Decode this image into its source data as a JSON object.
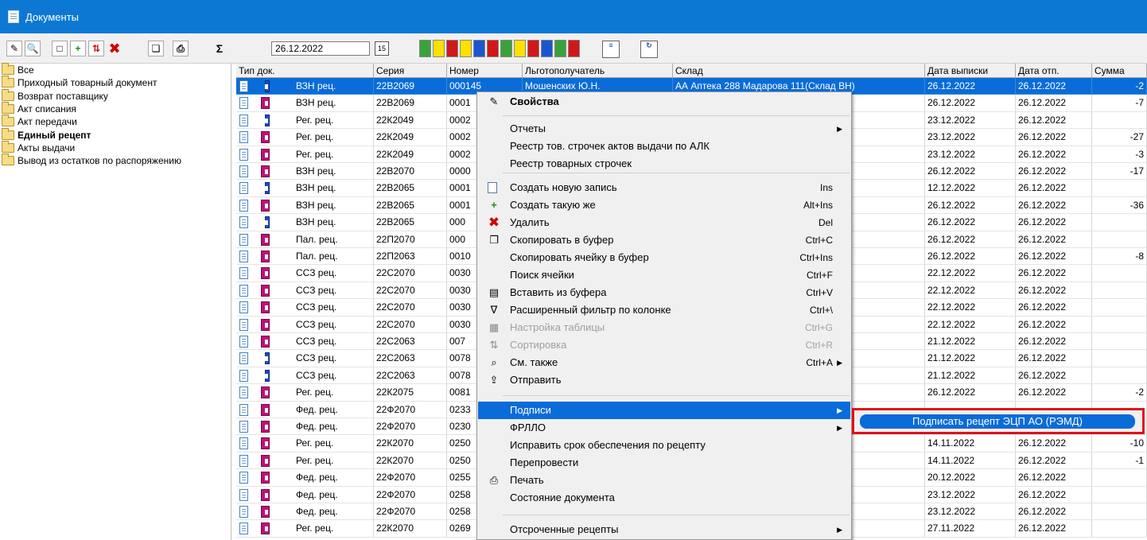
{
  "window": {
    "title": "Документы"
  },
  "toolbar": {
    "date_value": "26.12.2022",
    "calendar_label": "15"
  },
  "tree": {
    "items": [
      {
        "label": "Все"
      },
      {
        "label": "Приходный товарный документ"
      },
      {
        "label": "Возврат поставщику"
      },
      {
        "label": "Акт списания"
      },
      {
        "label": "Акт передачи"
      },
      {
        "label": "Единый рецепт",
        "bold": true
      },
      {
        "label": "Акты выдачи"
      },
      {
        "label": "Вывод из остатков по распоряжению"
      }
    ]
  },
  "grid": {
    "columns": [
      "Тип док.",
      "Серия",
      "Номер",
      "Льготополучатель",
      "Склад",
      "Дата выписки",
      "Дата отп.",
      "Сумма"
    ],
    "rows": [
      {
        "type": "ВЗН рец.",
        "series": "22В2069",
        "number": "000145",
        "patient": "Мошенских Ю.Н.",
        "warehouse": "АА Аптека 288 Мадарова 111(Склад ВН)",
        "issue_date": "26.12.2022",
        "release_date": "26.12.2022",
        "sum": "-2",
        "tag": "blue",
        "selected": true
      },
      {
        "type": "ВЗН рец.",
        "series": "22В2069",
        "number": "0001",
        "patient": "",
        "warehouse": "лад ВН)",
        "issue_date": "26.12.2022",
        "release_date": "26.12.2022",
        "sum": "-7",
        "tag": "pink"
      },
      {
        "type": "Рег. рец.",
        "series": "22К2049",
        "number": "0002",
        "patient": "",
        "warehouse": "лад РЛ)",
        "issue_date": "23.12.2022",
        "release_date": "26.12.2022",
        "sum": "",
        "tag": "blue"
      },
      {
        "type": "Рег. рец.",
        "series": "22К2049",
        "number": "0002",
        "patient": "",
        "warehouse": "лад РЛ)",
        "issue_date": "23.12.2022",
        "release_date": "26.12.2022",
        "sum": "-27",
        "tag": "pink"
      },
      {
        "type": "Рег. рец.",
        "series": "22К2049",
        "number": "0002",
        "patient": "",
        "warehouse": "лад РЛ)",
        "issue_date": "23.12.2022",
        "release_date": "26.12.2022",
        "sum": "-3",
        "tag": "pink"
      },
      {
        "type": "ВЗН рец.",
        "series": "22В2070",
        "number": "0000",
        "patient": "",
        "warehouse": "лад ВН)",
        "issue_date": "26.12.2022",
        "release_date": "26.12.2022",
        "sum": "-17",
        "tag": "pink"
      },
      {
        "type": "ВЗН рец.",
        "series": "22В2065",
        "number": "0001",
        "patient": "",
        "warehouse": "лад ВН)",
        "issue_date": "12.12.2022",
        "release_date": "26.12.2022",
        "sum": "",
        "tag": "blue"
      },
      {
        "type": "ВЗН рец.",
        "series": "22В2065",
        "number": "0001",
        "patient": "",
        "warehouse": "лад ВН)",
        "issue_date": "26.12.2022",
        "release_date": "26.12.2022",
        "sum": "-36",
        "tag": "pink"
      },
      {
        "type": "ВЗН рец.",
        "series": "22В2065",
        "number": "000",
        "patient": "",
        "warehouse": "лад ВН)",
        "issue_date": "26.12.2022",
        "release_date": "26.12.2022",
        "sum": "",
        "tag": "blue"
      },
      {
        "type": "Пал. рец.",
        "series": "22П2070",
        "number": "000",
        "patient": "",
        "warehouse": "лад ПЛ)",
        "issue_date": "26.12.2022",
        "release_date": "26.12.2022",
        "sum": "",
        "tag": "pink"
      },
      {
        "type": "Пал. рец.",
        "series": "22П2063",
        "number": "0010",
        "patient": "",
        "warehouse": "лад ПЛ)",
        "issue_date": "26.12.2022",
        "release_date": "26.12.2022",
        "sum": "-8",
        "tag": "pink"
      },
      {
        "type": "ССЗ рец.",
        "series": "22С2070",
        "number": "0030",
        "patient": "",
        "warehouse": "клад СЗ)",
        "issue_date": "22.12.2022",
        "release_date": "26.12.2022",
        "sum": "",
        "tag": "pink"
      },
      {
        "type": "ССЗ рец.",
        "series": "22С2070",
        "number": "0030",
        "patient": "",
        "warehouse": "клад СЗ)",
        "issue_date": "22.12.2022",
        "release_date": "26.12.2022",
        "sum": "",
        "tag": "pink"
      },
      {
        "type": "ССЗ рец.",
        "series": "22С2070",
        "number": "0030",
        "patient": "",
        "warehouse": "клад СЗ)",
        "issue_date": "22.12.2022",
        "release_date": "26.12.2022",
        "sum": "",
        "tag": "pink"
      },
      {
        "type": "ССЗ рец.",
        "series": "22С2070",
        "number": "0030",
        "patient": "",
        "warehouse": "клад СЗ)",
        "issue_date": "22.12.2022",
        "release_date": "26.12.2022",
        "sum": "",
        "tag": "pink"
      },
      {
        "type": "ССЗ рец.",
        "series": "22С2063",
        "number": "007",
        "patient": "",
        "warehouse": "клад СЗ)",
        "issue_date": "21.12.2022",
        "release_date": "26.12.2022",
        "sum": "",
        "tag": "pink"
      },
      {
        "type": "ССЗ рец.",
        "series": "22С2063",
        "number": "0078",
        "patient": "",
        "warehouse": "клад СЗ)",
        "issue_date": "21.12.2022",
        "release_date": "26.12.2022",
        "sum": "",
        "tag": "blue"
      },
      {
        "type": "ССЗ рец.",
        "series": "22С2063",
        "number": "0078",
        "patient": "",
        "warehouse": "клад СЗ)",
        "issue_date": "21.12.2022",
        "release_date": "26.12.2022",
        "sum": "",
        "tag": "blue"
      },
      {
        "type": "Рег. рец.",
        "series": "22К2075",
        "number": "0081",
        "patient": "",
        "warehouse": "лад РЛ)",
        "issue_date": "26.12.2022",
        "release_date": "26.12.2022",
        "sum": "-2",
        "tag": "pink"
      },
      {
        "type": "Фед. рец.",
        "series": "22Ф2070",
        "number": "0233",
        "patient": "",
        "warehouse": "",
        "issue_date": "",
        "release_date": "",
        "sum": "",
        "tag": "pink"
      },
      {
        "type": "Фед. рец.",
        "series": "22Ф2070",
        "number": "0230",
        "patient": "",
        "warehouse": "",
        "issue_date": "",
        "release_date": "",
        "sum": "",
        "tag": "pink"
      },
      {
        "type": "Рег. рец.",
        "series": "22К2070",
        "number": "0250",
        "patient": "",
        "warehouse": "лад РЛ)",
        "issue_date": "14.11.2022",
        "release_date": "26.12.2022",
        "sum": "-10",
        "tag": "pink"
      },
      {
        "type": "Рег. рец.",
        "series": "22К2070",
        "number": "0250",
        "patient": "",
        "warehouse": "лад РЛ)",
        "issue_date": "14.11.2022",
        "release_date": "26.12.2022",
        "sum": "-1",
        "tag": "pink"
      },
      {
        "type": "Фед. рец.",
        "series": "22Ф2070",
        "number": "0255",
        "patient": "",
        "warehouse": "лад ФЛ)",
        "issue_date": "20.12.2022",
        "release_date": "26.12.2022",
        "sum": "",
        "tag": "pink"
      },
      {
        "type": "Фед. рец.",
        "series": "22Ф2070",
        "number": "0258",
        "patient": "",
        "warehouse": "лад ФЛ)",
        "issue_date": "23.12.2022",
        "release_date": "26.12.2022",
        "sum": "",
        "tag": "pink"
      },
      {
        "type": "Фед. рец.",
        "series": "22Ф2070",
        "number": "0258",
        "patient": "",
        "warehouse": "лад ФЛ)",
        "issue_date": "23.12.2022",
        "release_date": "26.12.2022",
        "sum": "",
        "tag": "pink"
      },
      {
        "type": "Рег. рец.",
        "series": "22К2070",
        "number": "0269",
        "patient": "",
        "warehouse": "лад РЛ)",
        "issue_date": "27.11.2022",
        "release_date": "26.12.2022",
        "sum": "",
        "tag": "pink"
      }
    ]
  },
  "context_menu": {
    "items": [
      {
        "label": "Свойства",
        "bold": true,
        "icon": "properties-icon"
      },
      {
        "label": "Отчеты",
        "submenu": true
      },
      {
        "label": "Реестр тов. строчек актов выдачи по АЛК"
      },
      {
        "label": "Реестр товарных строчек"
      },
      {
        "label": "Создать новую запись",
        "shortcut": "Ins",
        "icon": "new-record-icon"
      },
      {
        "label": "Создать такую же",
        "shortcut": "Alt+Ins",
        "icon": "duplicate-icon"
      },
      {
        "label": "Удалить",
        "shortcut": "Del",
        "icon": "delete-icon"
      },
      {
        "label": "Скопировать в буфер",
        "shortcut": "Ctrl+C",
        "icon": "copy-icon"
      },
      {
        "label": "Скопировать ячейку в буфер",
        "shortcut": "Ctrl+Ins"
      },
      {
        "label": "Поиск ячейки",
        "shortcut": "Ctrl+F"
      },
      {
        "label": "Вставить из буфера",
        "shortcut": "Ctrl+V",
        "icon": "paste-icon"
      },
      {
        "label": "Расширенный фильтр по колонке",
        "shortcut": "Ctrl+\\",
        "icon": "filter-icon"
      },
      {
        "label": "Настройка таблицы",
        "shortcut": "Ctrl+G",
        "disabled": true,
        "icon": "table-settings-icon"
      },
      {
        "label": "Сортировка",
        "shortcut": "Ctrl+R",
        "disabled": true,
        "icon": "sort-icon"
      },
      {
        "label": "См. также",
        "shortcut": "Ctrl+A",
        "submenu": true,
        "icon": "see-also-icon"
      },
      {
        "label": "Отправить",
        "icon": "send-icon"
      },
      {
        "label": "Подписи",
        "submenu": true,
        "highlighted": true
      },
      {
        "label": "ФРЛЛО",
        "submenu": true
      },
      {
        "label": "Исправить срок обеспечения по рецепту"
      },
      {
        "label": "Перепровести"
      },
      {
        "label": "Печать",
        "icon": "print-icon"
      },
      {
        "label": "Состояние документа"
      },
      {
        "label": "Отсроченные рецепты",
        "submenu": true
      }
    ]
  },
  "submenu": {
    "item_label": "Подписать рецепт ЭЦП АО (РЭМД)"
  },
  "colors": {
    "titlebar": "#0d78d4",
    "selection": "#0a6cd8",
    "highlight_box": "#e0101a"
  }
}
